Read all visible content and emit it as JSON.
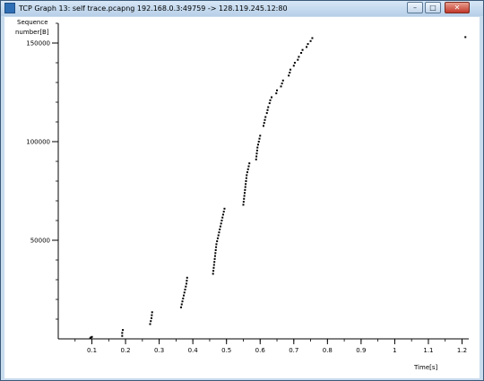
{
  "window": {
    "title": "TCP Graph 13: self trace.pcapng 192.168.0.3:49759 -> 128.119.245.12:80",
    "controls": {
      "minimize": "–",
      "maximize": "□",
      "close": "✕"
    }
  },
  "chart_data": {
    "type": "scatter",
    "ylabel_line1": "Sequence",
    "ylabel_line2": "number[B]",
    "xlabel": "Time[s]",
    "xlim": [
      0.0,
      1.22
    ],
    "ylim": [
      0,
      160000
    ],
    "x_ticks": [
      {
        "value": 0.1,
        "label": "0.1"
      },
      {
        "value": 0.2,
        "label": "0.2"
      },
      {
        "value": 0.3,
        "label": "0.3"
      },
      {
        "value": 0.4,
        "label": "0.4"
      },
      {
        "value": 0.5,
        "label": "0.5"
      },
      {
        "value": 0.6,
        "label": "0.6"
      },
      {
        "value": 0.7,
        "label": "0.7"
      },
      {
        "value": 0.8,
        "label": "0.8"
      },
      {
        "value": 0.9,
        "label": "0.9"
      },
      {
        "value": 1.0,
        "label": "1"
      },
      {
        "value": 1.1,
        "label": "1.1"
      },
      {
        "value": 1.2,
        "label": "1.2"
      }
    ],
    "y_ticks": [
      {
        "value": 50000,
        "label": "50000"
      },
      {
        "value": 100000,
        "label": "100000"
      },
      {
        "value": 150000,
        "label": "150000"
      }
    ],
    "y_minor_step": 10000,
    "x_minor_step": 0.05,
    "points": [
      [
        0.095,
        300
      ],
      [
        0.097,
        700
      ],
      [
        0.1,
        1000
      ],
      [
        0.19,
        1500
      ],
      [
        0.19,
        3000
      ],
      [
        0.192,
        4500
      ],
      [
        0.273,
        7500
      ],
      [
        0.275,
        9000
      ],
      [
        0.277,
        10500
      ],
      [
        0.278,
        12000
      ],
      [
        0.279,
        13500
      ],
      [
        0.365,
        16000
      ],
      [
        0.367,
        17500
      ],
      [
        0.369,
        19000
      ],
      [
        0.371,
        20500
      ],
      [
        0.373,
        22000
      ],
      [
        0.375,
        23500
      ],
      [
        0.377,
        25000
      ],
      [
        0.379,
        26500
      ],
      [
        0.381,
        28000
      ],
      [
        0.382,
        29500
      ],
      [
        0.383,
        31000
      ],
      [
        0.46,
        33000
      ],
      [
        0.461,
        34500
      ],
      [
        0.462,
        36000
      ],
      [
        0.463,
        37500
      ],
      [
        0.464,
        39000
      ],
      [
        0.465,
        40500
      ],
      [
        0.466,
        42000
      ],
      [
        0.467,
        43500
      ],
      [
        0.468,
        45000
      ],
      [
        0.469,
        46500
      ],
      [
        0.47,
        48000
      ],
      [
        0.472,
        49500
      ],
      [
        0.474,
        51000
      ],
      [
        0.476,
        52500
      ],
      [
        0.478,
        54000
      ],
      [
        0.48,
        55500
      ],
      [
        0.482,
        57000
      ],
      [
        0.484,
        58500
      ],
      [
        0.486,
        60000
      ],
      [
        0.488,
        61500
      ],
      [
        0.49,
        63000
      ],
      [
        0.492,
        64500
      ],
      [
        0.494,
        66000
      ],
      [
        0.55,
        68000
      ],
      [
        0.551,
        69500
      ],
      [
        0.552,
        71000
      ],
      [
        0.553,
        72500
      ],
      [
        0.554,
        74000
      ],
      [
        0.555,
        75500
      ],
      [
        0.556,
        77000
      ],
      [
        0.557,
        78500
      ],
      [
        0.558,
        80000
      ],
      [
        0.559,
        81500
      ],
      [
        0.56,
        83000
      ],
      [
        0.562,
        84500
      ],
      [
        0.564,
        86000
      ],
      [
        0.566,
        87500
      ],
      [
        0.568,
        89000
      ],
      [
        0.588,
        91000
      ],
      [
        0.589,
        92500
      ],
      [
        0.59,
        94000
      ],
      [
        0.591,
        95500
      ],
      [
        0.592,
        97000
      ],
      [
        0.594,
        98500
      ],
      [
        0.596,
        100000
      ],
      [
        0.598,
        101500
      ],
      [
        0.6,
        103000
      ],
      [
        0.61,
        108000
      ],
      [
        0.612,
        109500
      ],
      [
        0.614,
        111000
      ],
      [
        0.616,
        112500
      ],
      [
        0.62,
        114500
      ],
      [
        0.622,
        116000
      ],
      [
        0.624,
        117500
      ],
      [
        0.628,
        119500
      ],
      [
        0.63,
        121000
      ],
      [
        0.634,
        122500
      ],
      [
        0.648,
        124500
      ],
      [
        0.65,
        126000
      ],
      [
        0.662,
        128000
      ],
      [
        0.665,
        129500
      ],
      [
        0.668,
        131000
      ],
      [
        0.685,
        133500
      ],
      [
        0.688,
        135000
      ],
      [
        0.69,
        136500
      ],
      [
        0.7,
        138500
      ],
      [
        0.703,
        140000
      ],
      [
        0.712,
        141500
      ],
      [
        0.715,
        143000
      ],
      [
        0.722,
        145000
      ],
      [
        0.726,
        146500
      ],
      [
        0.738,
        148000
      ],
      [
        0.742,
        149500
      ],
      [
        0.75,
        151000
      ],
      [
        0.755,
        152500
      ],
      [
        1.21,
        153000
      ]
    ]
  }
}
